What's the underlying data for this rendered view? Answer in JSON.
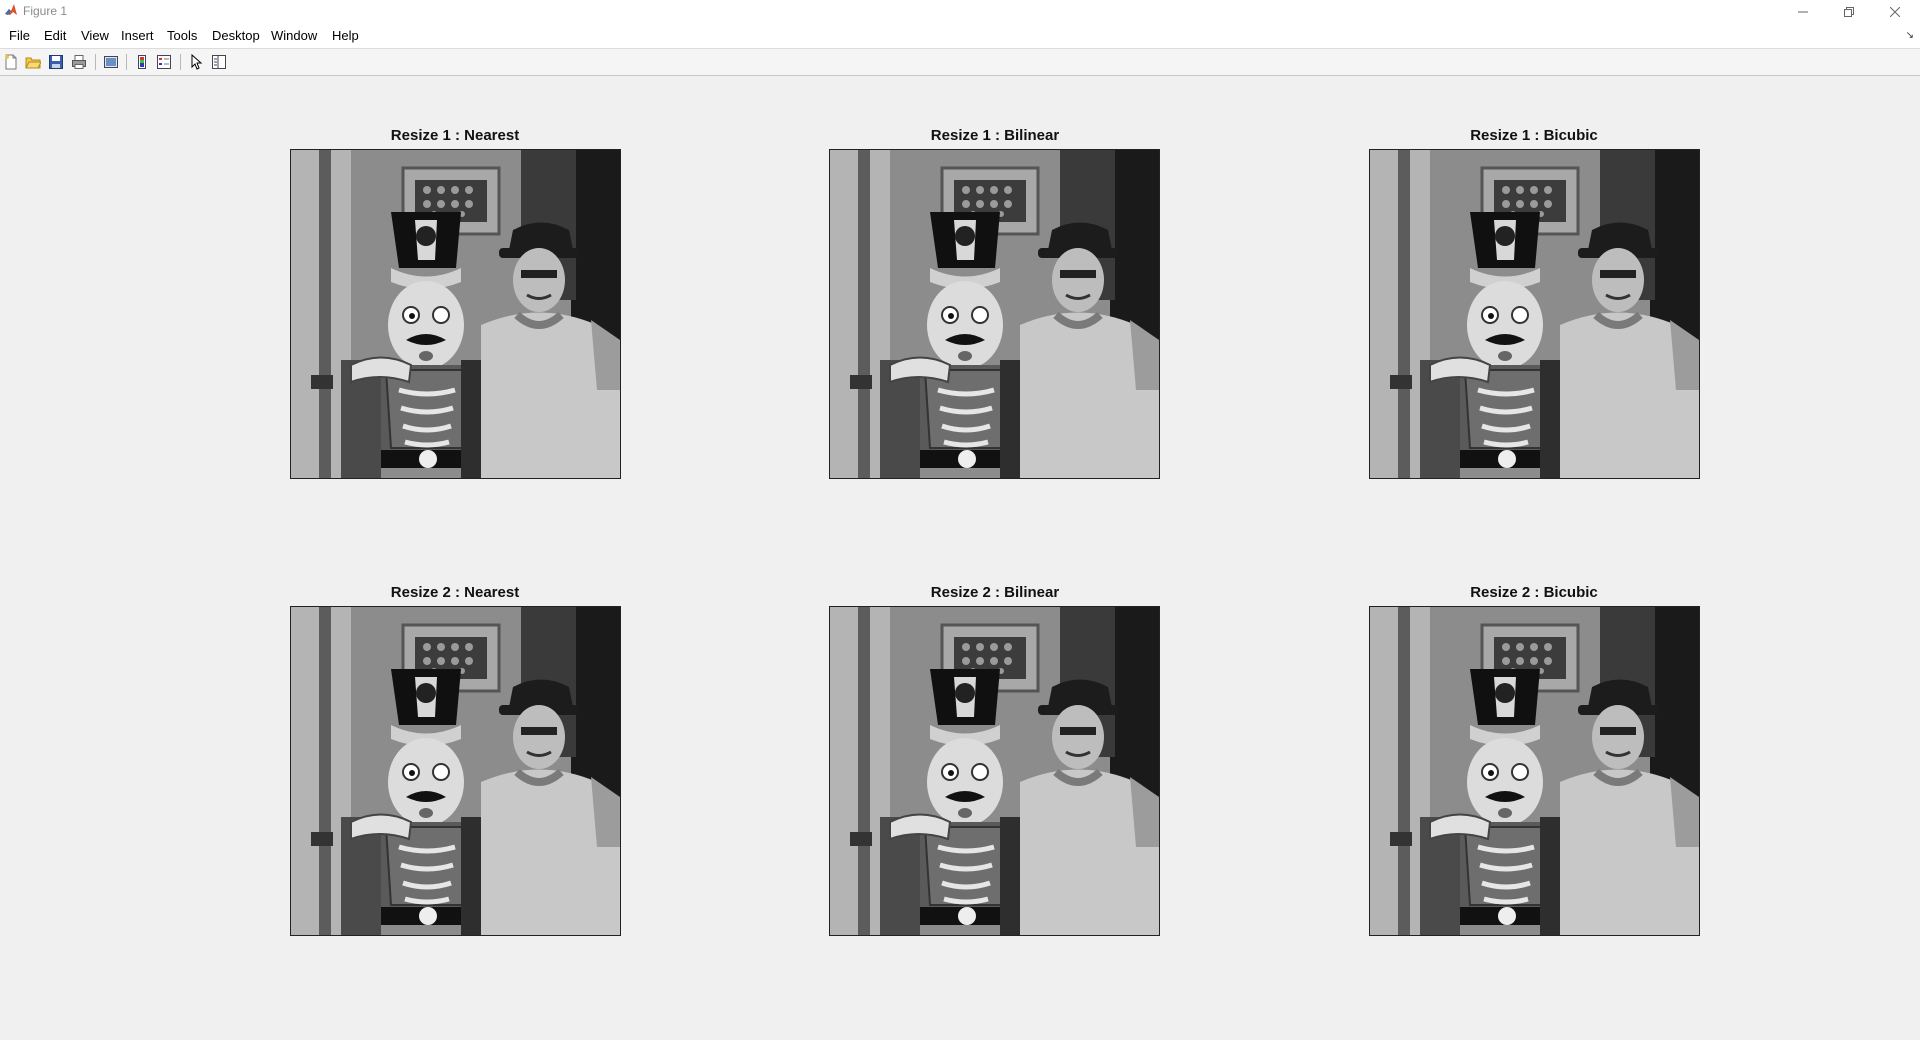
{
  "window": {
    "title": "Figure 1",
    "controls": [
      "minimize",
      "restore",
      "close"
    ]
  },
  "menu": {
    "items": [
      "File",
      "Edit",
      "View",
      "Insert",
      "Tools",
      "Desktop",
      "Window",
      "Help"
    ]
  },
  "toolbar": {
    "icons": [
      "new-figure-icon",
      "open-file-icon",
      "save-icon",
      "print-icon",
      "link-plot-icon",
      "colorbar-icon",
      "legend-icon",
      "edit-plot-icon",
      "property-inspector-icon"
    ]
  },
  "figure": {
    "subplots": [
      {
        "title": "Resize 1 : Nearest"
      },
      {
        "title": "Resize 1 : Bilinear"
      },
      {
        "title": "Resize 1 : Bicubic"
      },
      {
        "title": "Resize 2 : Nearest"
      },
      {
        "title": "Resize 2 : Bilinear"
      },
      {
        "title": "Resize 2 : Bicubic"
      }
    ],
    "image_description": "grayscale photo"
  },
  "colors": {
    "background": "#f0f0f0",
    "titlebar": "#ffffff"
  }
}
